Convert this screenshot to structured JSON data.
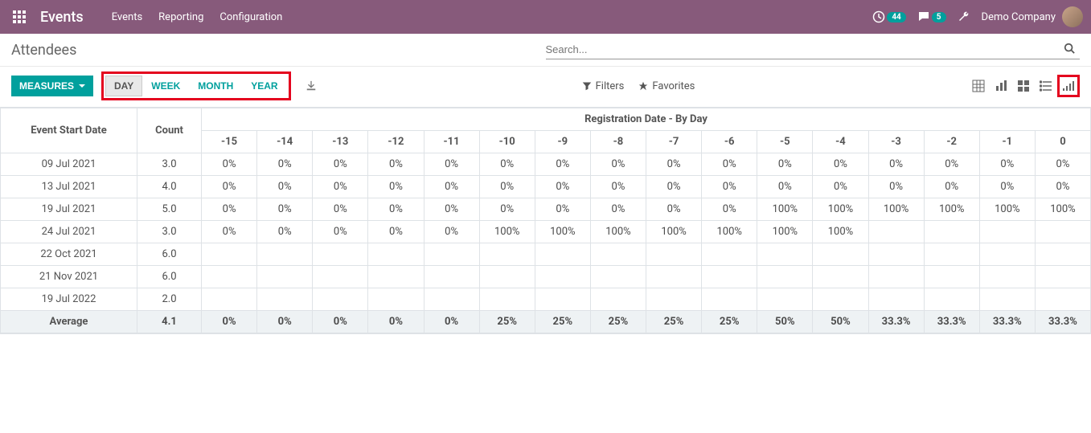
{
  "topbar": {
    "brand": "Events",
    "nav": [
      "Events",
      "Reporting",
      "Configuration"
    ],
    "clock_badge": "44",
    "chat_badge": "5",
    "company": "Demo Company"
  },
  "subhead": {
    "title": "Attendees",
    "search_placeholder": "Search..."
  },
  "toolbar": {
    "measures_label": "MEASURES",
    "periods": [
      "DAY",
      "WEEK",
      "MONTH",
      "YEAR"
    ],
    "active_period": "DAY",
    "filters_label": "Filters",
    "favorites_label": "Favorites"
  },
  "grid": {
    "row_header": "Event Start Date",
    "count_header": "Count",
    "col_group_header": "Registration Date - By Day",
    "columns": [
      "-15",
      "-14",
      "-13",
      "-12",
      "-11",
      "-10",
      "-9",
      "-8",
      "-7",
      "-6",
      "-5",
      "-4",
      "-3",
      "-2",
      "-1",
      "0"
    ],
    "rows": [
      {
        "label": "09 Jul 2021",
        "count": "3.0",
        "cells": [
          "0%",
          "0%",
          "0%",
          "0%",
          "0%",
          "0%",
          "0%",
          "0%",
          "0%",
          "0%",
          "0%",
          "0%",
          "0%",
          "0%",
          "0%",
          "0%"
        ]
      },
      {
        "label": "13 Jul 2021",
        "count": "4.0",
        "cells": [
          "0%",
          "0%",
          "0%",
          "0%",
          "0%",
          "0%",
          "0%",
          "0%",
          "0%",
          "0%",
          "0%",
          "0%",
          "0%",
          "0%",
          "0%",
          "0%"
        ]
      },
      {
        "label": "19 Jul 2021",
        "count": "5.0",
        "cells": [
          "0%",
          "0%",
          "0%",
          "0%",
          "0%",
          "0%",
          "0%",
          "0%",
          "0%",
          "0%",
          "100%",
          "100%",
          "100%",
          "100%",
          "100%",
          "100%"
        ]
      },
      {
        "label": "24 Jul 2021",
        "count": "3.0",
        "cells": [
          "0%",
          "0%",
          "0%",
          "0%",
          "0%",
          "100%",
          "100%",
          "100%",
          "100%",
          "100%",
          "100%",
          "100%",
          "",
          "",
          "",
          ""
        ]
      },
      {
        "label": "22 Oct 2021",
        "count": "6.0",
        "cells": [
          "",
          "",
          "",
          "",
          "",
          "",
          "",
          "",
          "",
          "",
          "",
          "",
          "",
          "",
          "",
          ""
        ]
      },
      {
        "label": "21 Nov 2021",
        "count": "6.0",
        "cells": [
          "",
          "",
          "",
          "",
          "",
          "",
          "",
          "",
          "",
          "",
          "",
          "",
          "",
          "",
          "",
          ""
        ]
      },
      {
        "label": "19 Jul 2022",
        "count": "2.0",
        "cells": [
          "",
          "",
          "",
          "",
          "",
          "",
          "",
          "",
          "",
          "",
          "",
          "",
          "",
          "",
          "",
          ""
        ]
      }
    ],
    "average": {
      "label": "Average",
      "count": "4.1",
      "cells": [
        "0%",
        "0%",
        "0%",
        "0%",
        "0%",
        "25%",
        "25%",
        "25%",
        "25%",
        "25%",
        "50%",
        "50%",
        "33.3%",
        "33.3%",
        "33.3%",
        "33.3%"
      ]
    }
  }
}
